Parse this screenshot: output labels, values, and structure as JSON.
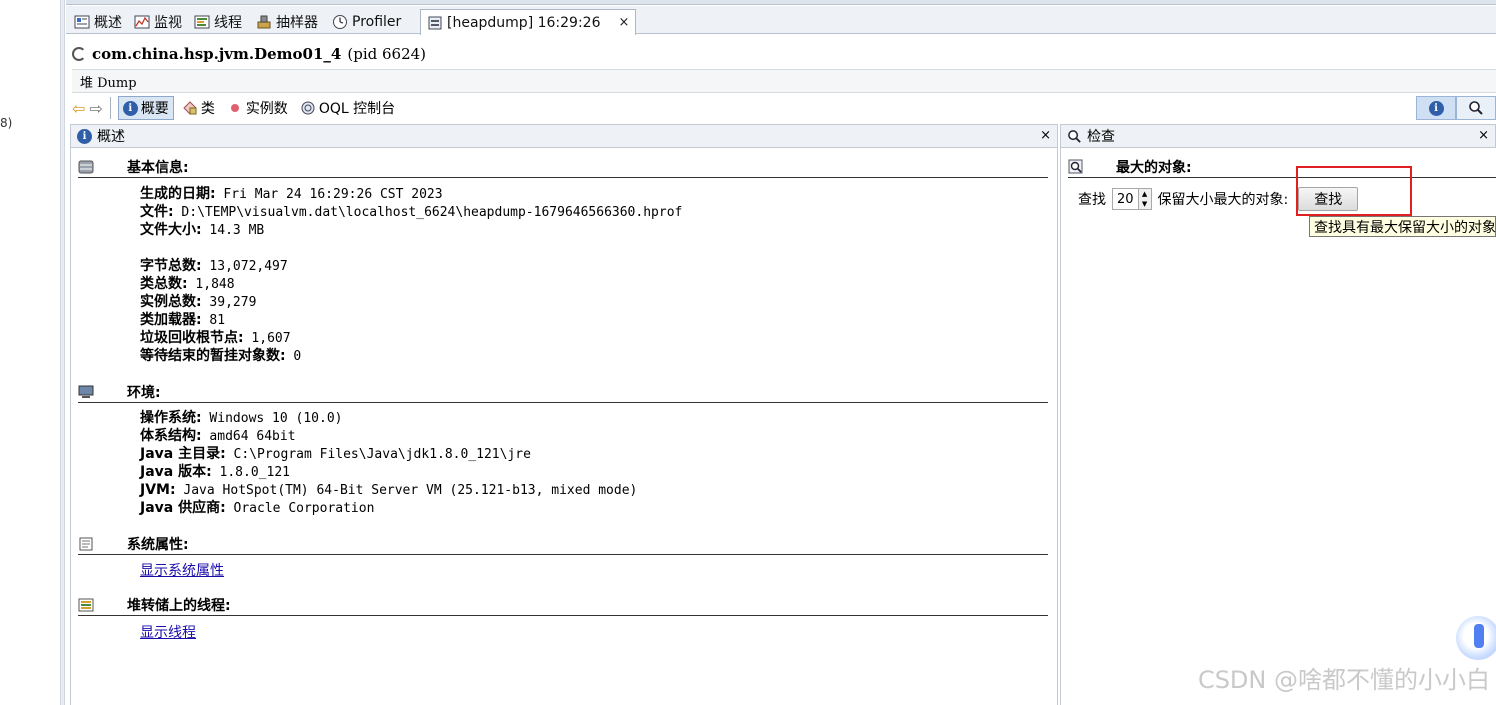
{
  "left_fragment": "8)",
  "tabs": [
    {
      "label": "概述",
      "icon": "overview-icon"
    },
    {
      "label": "监视",
      "icon": "monitor-icon"
    },
    {
      "label": "线程",
      "icon": "threads-icon"
    },
    {
      "label": "抽样器",
      "icon": "sampler-icon"
    },
    {
      "label": "Profiler",
      "icon": "profiler-icon"
    },
    {
      "label": "[heapdump] 16:29:26",
      "icon": "heapdump-icon",
      "active": true,
      "close": "×"
    }
  ],
  "title": {
    "app": "com.china.hsp.jvm.Demo01_4",
    "pid": "(pid 6624)"
  },
  "dump_label": "堆 Dump",
  "toolbar": {
    "summary": "概要",
    "classes": "类",
    "instances": "实例数",
    "oql": "OQL 控制台"
  },
  "left_panel": {
    "title": "概述",
    "close": "×",
    "basic": {
      "heading": "基本信息:",
      "items": [
        {
          "k": "生成的日期:",
          "v": " Fri Mar 24 16:29:26 CST 2023"
        },
        {
          "k": "文件:",
          "v": " D:\\TEMP\\visualvm.dat\\localhost_6624\\heapdump-1679646566360.hprof"
        },
        {
          "k": "文件大小:",
          "v": " 14.3 MB"
        },
        {
          "k": "字节总数:",
          "v": " 13,072,497"
        },
        {
          "k": "类总数:",
          "v": " 1,848"
        },
        {
          "k": "实例总数:",
          "v": " 39,279"
        },
        {
          "k": "类加载器:",
          "v": " 81"
        },
        {
          "k": "垃圾回收根节点:",
          "v": " 1,607"
        },
        {
          "k": "等待结束的暂挂对象数:",
          "v": " 0"
        }
      ]
    },
    "env": {
      "heading": "环境:",
      "items": [
        {
          "k": "操作系统:",
          "v": " Windows 10 (10.0)"
        },
        {
          "k": "体系结构:",
          "v": " amd64 64bit"
        },
        {
          "k": "Java 主目录:",
          "v": " C:\\Program Files\\Java\\jdk1.8.0_121\\jre"
        },
        {
          "k": "Java 版本:",
          "v": " 1.8.0_121"
        },
        {
          "k": "JVM:",
          "v": " Java HotSpot(TM) 64-Bit Server VM (25.121-b13, mixed mode)"
        },
        {
          "k": "Java 供应商:",
          "v": " Oracle Corporation"
        }
      ]
    },
    "sysprops": {
      "heading": "系统属性:",
      "link": "显示系统属性"
    },
    "threads": {
      "heading": "堆转储上的线程:",
      "link": "显示线程"
    }
  },
  "right_panel": {
    "title": "检查",
    "close": "×",
    "largest_heading": "最大的对象:",
    "find_label": "查找",
    "count": "20",
    "suffix": "保留大小最大的对象:",
    "button": "查找",
    "tooltip": "查找具有最大保留大小的对象"
  },
  "watermark": "CSDN @啥都不懂的小小白",
  "colors": {
    "highlight_box": "#e02020",
    "link": "#1a0dab",
    "tooltip_bg": "#ffffe1"
  }
}
